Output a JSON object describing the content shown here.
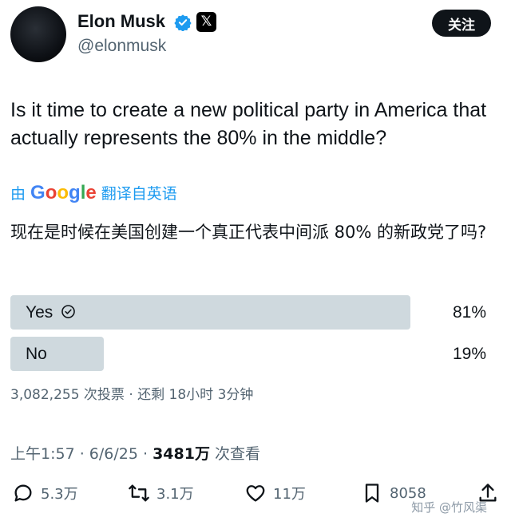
{
  "profile": {
    "name": "Elon Musk",
    "handle": "@elonmusk",
    "x_badge": "𝕏"
  },
  "follow_label": "关注",
  "tweet": {
    "text": "Is it time to create a new political party in America that actually represents the 80% in the middle?"
  },
  "translation": {
    "by": "由",
    "google": [
      "G",
      "o",
      "o",
      "g",
      "l",
      "e"
    ],
    "google_colors": [
      "#4285F4",
      "#EA4335",
      "#FBBC05",
      "#4285F4",
      "#34A853",
      "#EA4335"
    ],
    "suffix": "翻译自英语",
    "text": "现在是时候在美国创建一个真正代表中间派 80% 的新政党了吗?"
  },
  "poll": {
    "options": [
      {
        "label": "Yes",
        "percent_text": "81%",
        "percent": 81,
        "winner": true
      },
      {
        "label": "No",
        "percent_text": "19%",
        "percent": 19,
        "winner": false
      }
    ],
    "meta": "3,082,255 次投票 · 还剩 18小时 3分钟"
  },
  "timestamp": "上午1:57 · 6/6/25 · ",
  "views_count": "3481万",
  "views_label": " 次查看",
  "actions": {
    "replies": "5.3万",
    "reposts": "3.1万",
    "likes": "11万",
    "bookmarks": "8058"
  },
  "watermark": "知乎 @竹风渠",
  "colors": {
    "bar": "#cfd9de",
    "accent": "#1d9bf0",
    "follow_bg": "#0f1419"
  }
}
